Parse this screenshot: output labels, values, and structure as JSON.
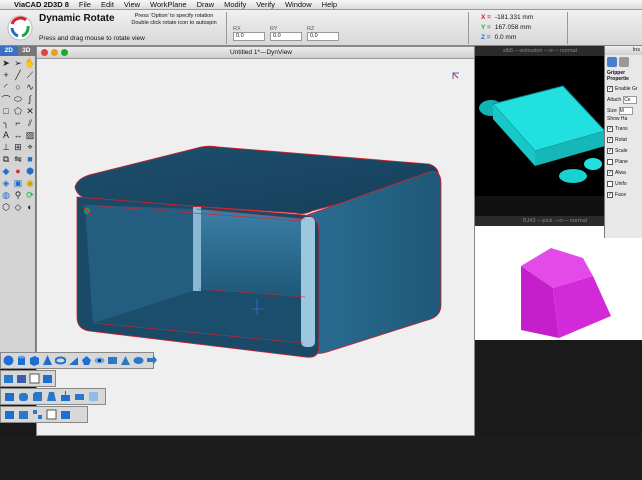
{
  "menubar": {
    "app_name": "ViaCAD 2D3D 8",
    "items": [
      "File",
      "Edit",
      "View",
      "WorkPlane",
      "Draw",
      "Modify",
      "Verify",
      "Window",
      "Help"
    ]
  },
  "toolbar": {
    "tool_name": "Dynamic Rotate",
    "hint": "Press and drag mouse to rotate view",
    "option_line1": "Press 'Option' to specify rotation",
    "option_line2": "Double click rotate icon to autospin",
    "fields": [
      {
        "label": "RX",
        "value": "0.0"
      },
      {
        "label": "RY",
        "value": "0.0"
      },
      {
        "label": "RZ",
        "value": "0.0"
      }
    ]
  },
  "coords": {
    "x_label": "X =",
    "x_value": "-181.331 mm",
    "y_label": "Y =",
    "y_value": "167.058 mm",
    "z_label": "Z =",
    "z_value": "0.0 mm"
  },
  "left_toolbar": {
    "tab_2d": "2D",
    "tab_3d": "3D"
  },
  "document": {
    "title": "Untitled 1*---DynView"
  },
  "background_windows": {
    "win1_title": "slb5 ---extrusion ---rr--- normal",
    "win2_title": "BJ43 ---pick ---rr--- normal"
  },
  "properties": {
    "header": "Ins",
    "title": "Gripper Propertie",
    "enable": "Enable Gr",
    "attach_label": "Attach",
    "attach_value": "Ce",
    "size_label": "Size",
    "size_value": "M",
    "show_handles_title": "Show Ha",
    "options": [
      {
        "label": "Trans",
        "checked": true
      },
      {
        "label": "Rotat",
        "checked": true
      },
      {
        "label": "Scale",
        "checked": true
      },
      {
        "label": "Plane",
        "checked": false
      },
      {
        "label": "Alwa",
        "checked": true
      },
      {
        "label": "Unifo",
        "checked": false
      },
      {
        "label": "Face",
        "checked": true
      }
    ]
  },
  "colors": {
    "accent_red": "#d8202a",
    "shape_blue": "#2b6f92",
    "cyan_part": "#22e0e0",
    "magenta_part": "#d22ad8"
  }
}
